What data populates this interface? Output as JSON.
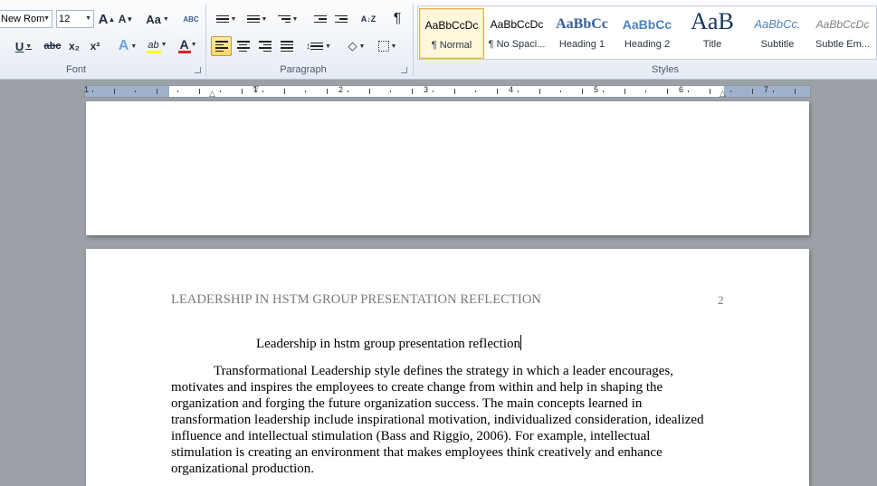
{
  "ribbon": {
    "font": {
      "font_name": "New Rom",
      "font_size": "12",
      "grow": "A",
      "shrink": "A",
      "case": "Aa",
      "clear_format": "ABC",
      "underline": "U",
      "strike": "abc",
      "subscript": "x₂",
      "superscript": "x²",
      "text_effects": "A",
      "highlight": "ab",
      "font_color": "A",
      "group_label": "Font"
    },
    "paragraph": {
      "show_marks": "¶",
      "group_label": "Paragraph"
    },
    "styles": {
      "group_label": "Styles",
      "items": [
        {
          "sample": "AaBbCcDc",
          "name": "¶ Normal"
        },
        {
          "sample": "AaBbCcDc",
          "name": "¶ No Spaci..."
        },
        {
          "sample": "AaBbCc",
          "name": "Heading 1"
        },
        {
          "sample": "AaBbCc",
          "name": "Heading 2"
        },
        {
          "sample": "AaB",
          "name": "Title"
        },
        {
          "sample": "AaBbCc.",
          "name": "Subtitle"
        },
        {
          "sample": "AaBbCcDc",
          "name": "Subtle Em..."
        }
      ]
    }
  },
  "ruler": {
    "numbers": [
      "1",
      "1",
      "2",
      "3",
      "4",
      "5",
      "6",
      "7"
    ]
  },
  "document": {
    "header": "LEADERSHIP IN HSTM GROUP PRESENTATION REFLECTION",
    "page_number": "2",
    "title": "Leadership in hstm group presentation reflection",
    "paragraph": "Transformational Leadership style defines the strategy in which a leader encourages, motivates and inspires the employees to create change from within and help in shaping the organization and forging the future organization success. The main concepts learned in transformation leadership include inspirational motivation, individualized consideration, idealized influence and intellectual stimulation (Bass and Riggio, 2006). For example, intellectual stimulation is creating an environment that makes employees think creatively and enhance organizational production."
  }
}
